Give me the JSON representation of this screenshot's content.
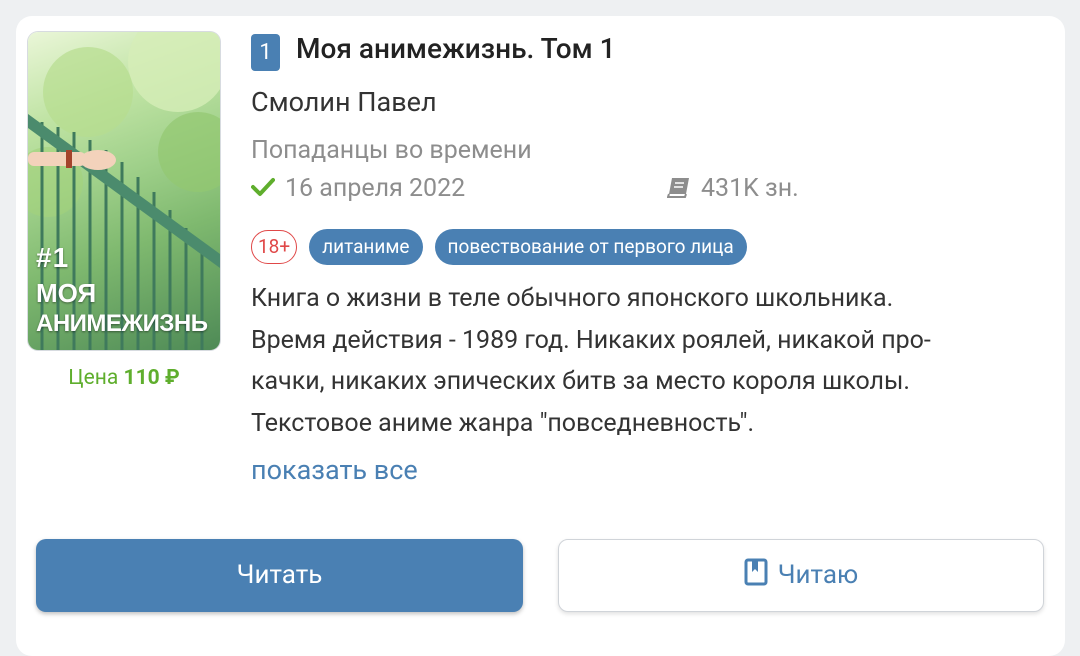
{
  "book": {
    "number": "1",
    "title": "Моя анимежизнь. Том 1",
    "author": "Смолин Павел",
    "series": "Попаданцы во времени",
    "date": "16 апреля 2022",
    "size": "431K зн.",
    "age_rating": "18+",
    "tags": [
      "литаниме",
      "повествование от первого лица"
    ],
    "description_lines": [
      "Книга о жизни в теле обычного японского школьника.",
      "Время действия - 1989 год. Никаких роялей, никакой про-",
      "качки, никаких эпических битв за место короля школы.",
      "Текстовое аниме жанра \"повседневность\"."
    ],
    "show_all": "показать все",
    "price_label": "Цена",
    "price_value": "110 ₽"
  },
  "cover": {
    "number_text": "#1",
    "title_line1": "МОЯ",
    "title_line2": "АНИМЕЖИЗНЬ"
  },
  "buttons": {
    "read": "Читать",
    "reading": "Читаю"
  },
  "colors": {
    "accent": "#4a80b3",
    "price_green": "#5fae2d",
    "age_red": "#e04848"
  },
  "icons": {
    "date": "check-icon",
    "size": "book-icon",
    "reading": "bookmark-icon"
  }
}
